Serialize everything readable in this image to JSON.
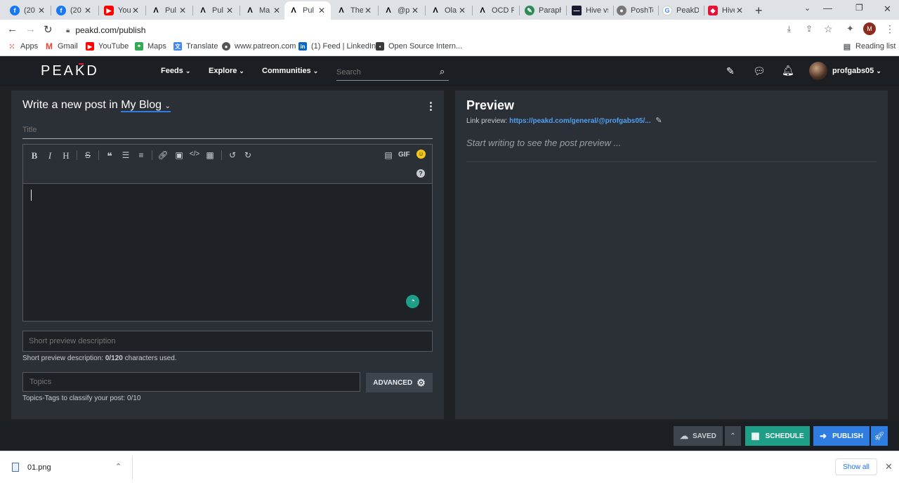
{
  "tabs": [
    {
      "title": "(20",
      "icon": "facebook-icon"
    },
    {
      "title": "(20",
      "icon": "facebook-icon"
    },
    {
      "title": "You",
      "icon": "youtube-icon"
    },
    {
      "title": "Pul",
      "icon": "peakd-icon"
    },
    {
      "title": "Pul",
      "icon": "peakd-icon"
    },
    {
      "title": "Ma",
      "icon": "peakd-icon"
    },
    {
      "title": "Pul",
      "icon": "peakd-icon"
    },
    {
      "title": "The",
      "icon": "peakd-icon"
    },
    {
      "title": "@p",
      "icon": "peakd-icon"
    },
    {
      "title": "Ola",
      "icon": "peakd-icon"
    },
    {
      "title": "OCD PC",
      "icon": "peakd-icon"
    },
    {
      "title": "Paraphr",
      "icon": "paraphrase-icon"
    },
    {
      "title": "Hive vs",
      "icon": "hive-doc-icon"
    },
    {
      "title": "PoshTok",
      "icon": "globe-icon"
    },
    {
      "title": "PeakD W",
      "icon": "google-icon"
    },
    {
      "title": "Hive.Blo",
      "icon": "hive-icon"
    }
  ],
  "browser": {
    "url": "peakd.com/publish",
    "reading_list": "Reading list"
  },
  "bookmarks": [
    {
      "label": "Apps",
      "icon": "apps-icon"
    },
    {
      "label": "Gmail",
      "icon": "gmail-icon"
    },
    {
      "label": "YouTube",
      "icon": "youtube-icon"
    },
    {
      "label": "Maps",
      "icon": "maps-icon"
    },
    {
      "label": "Translate",
      "icon": "translate-icon"
    },
    {
      "label": "www.patreon.com",
      "icon": "globe-icon"
    },
    {
      "label": "(1) Feed | LinkedIn",
      "icon": "linkedin-icon"
    },
    {
      "label": "Open Source Intern...",
      "icon": "bookmark-icon"
    }
  ],
  "header": {
    "logo": "PEAKD",
    "nav": [
      "Feeds",
      "Explore",
      "Communities"
    ],
    "search_placeholder": "Search",
    "username": "profgabs05"
  },
  "editor": {
    "heading_prefix": "Write a new post in",
    "blog": "My Blog",
    "title_placeholder": "Title",
    "toolbar": [
      "B",
      "I",
      "H",
      "S",
      "quote",
      "ordered-list",
      "bullet-list",
      "link",
      "image",
      "code",
      "table",
      "undo",
      "redo"
    ],
    "gif_label": "GIF",
    "desc_placeholder": "Short preview description",
    "desc_count_label": "Short preview description:",
    "desc_count": "0/120",
    "desc_count_suffix": "characters used.",
    "topics_placeholder": "Topics",
    "advanced_label": "ADVANCED",
    "topics_hint": "Topics-Tags to classify your post: 0/10"
  },
  "preview": {
    "title": "Preview",
    "link_label": "Link preview:",
    "link_url": "https://peakd.com/general/@profgabs05/...",
    "placeholder": "Start writing to see the post preview ..."
  },
  "actions": {
    "saved": "SAVED",
    "schedule": "SCHEDULE",
    "publish": "PUBLISH"
  },
  "download": {
    "filename": "01.png",
    "show_all": "Show all"
  },
  "colors": {
    "accent_green": "#1f9e87",
    "accent_blue": "#2f7de1",
    "panel": "#2b2f36"
  }
}
